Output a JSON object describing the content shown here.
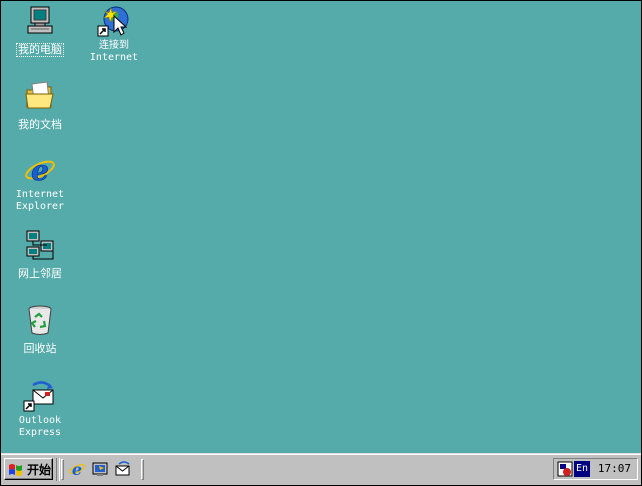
{
  "desktop": {
    "background": "#55aaaa",
    "icons": [
      {
        "id": "my-computer",
        "label": "我的电脑",
        "icon": "computer-icon",
        "selected": true
      },
      {
        "id": "connect-internet",
        "label": "连接到\nInternet",
        "icon": "connect-internet-icon"
      },
      {
        "id": "my-documents",
        "label": "我的文档",
        "icon": "folder-icon"
      },
      {
        "id": "internet-explorer",
        "label": "Internet\nExplorer",
        "icon": "ie-icon"
      },
      {
        "id": "network-neighborhood",
        "label": "网上邻居",
        "icon": "network-icon"
      },
      {
        "id": "recycle-bin",
        "label": "回收站",
        "icon": "recycle-bin-icon"
      },
      {
        "id": "outlook-express",
        "label": "Outlook\nExpress",
        "icon": "outlook-express-icon"
      }
    ]
  },
  "taskbar": {
    "start_label": "开始",
    "quick_launch": [
      "ie-icon",
      "show-desktop-icon",
      "outlook-icon"
    ],
    "tray": {
      "ime_label": "En",
      "clock": "17:07"
    }
  }
}
